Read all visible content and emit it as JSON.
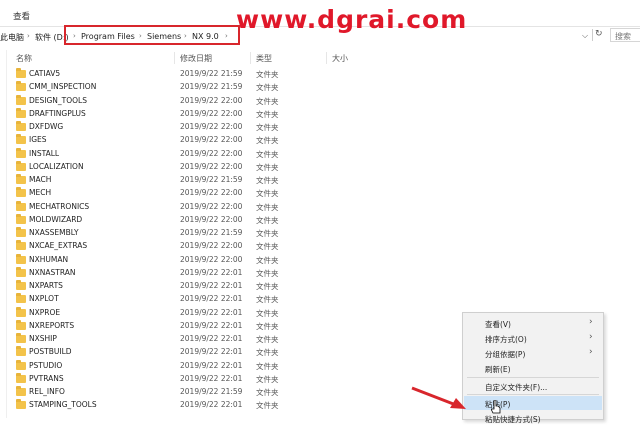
{
  "menubar": {
    "view": "查看"
  },
  "watermark": "www.dgrai.com",
  "address": {
    "pre1": "此电脑",
    "pre2": "软件 (D:)",
    "crumbs": [
      "Program Files",
      "Siemens",
      "NX 9.0"
    ]
  },
  "search_placeholder": "搜索",
  "columns": {
    "name": "名称",
    "date": "修改日期",
    "type": "类型",
    "size": "大小"
  },
  "files": [
    {
      "name": "CATIAV5",
      "date": "2019/9/22 21:59",
      "type": "文件夹"
    },
    {
      "name": "CMM_INSPECTION",
      "date": "2019/9/22 21:59",
      "type": "文件夹"
    },
    {
      "name": "DESIGN_TOOLS",
      "date": "2019/9/22 22:00",
      "type": "文件夹"
    },
    {
      "name": "DRAFTINGPLUS",
      "date": "2019/9/22 22:00",
      "type": "文件夹"
    },
    {
      "name": "DXFDWG",
      "date": "2019/9/22 22:00",
      "type": "文件夹"
    },
    {
      "name": "IGES",
      "date": "2019/9/22 22:00",
      "type": "文件夹"
    },
    {
      "name": "INSTALL",
      "date": "2019/9/22 22:00",
      "type": "文件夹"
    },
    {
      "name": "LOCALIZATION",
      "date": "2019/9/22 22:00",
      "type": "文件夹"
    },
    {
      "name": "MACH",
      "date": "2019/9/22 21:59",
      "type": "文件夹"
    },
    {
      "name": "MECH",
      "date": "2019/9/22 22:00",
      "type": "文件夹"
    },
    {
      "name": "MECHATRONICS",
      "date": "2019/9/22 22:00",
      "type": "文件夹"
    },
    {
      "name": "MOLDWIZARD",
      "date": "2019/9/22 22:00",
      "type": "文件夹"
    },
    {
      "name": "NXASSEMBLY",
      "date": "2019/9/22 21:59",
      "type": "文件夹"
    },
    {
      "name": "NXCAE_EXTRAS",
      "date": "2019/9/22 22:00",
      "type": "文件夹"
    },
    {
      "name": "NXHUMAN",
      "date": "2019/9/22 22:00",
      "type": "文件夹"
    },
    {
      "name": "NXNASTRAN",
      "date": "2019/9/22 22:01",
      "type": "文件夹"
    },
    {
      "name": "NXPARTS",
      "date": "2019/9/22 22:01",
      "type": "文件夹"
    },
    {
      "name": "NXPLOT",
      "date": "2019/9/22 22:01",
      "type": "文件夹"
    },
    {
      "name": "NXPROE",
      "date": "2019/9/22 22:01",
      "type": "文件夹"
    },
    {
      "name": "NXREPORTS",
      "date": "2019/9/22 22:01",
      "type": "文件夹"
    },
    {
      "name": "NXSHIP",
      "date": "2019/9/22 22:01",
      "type": "文件夹"
    },
    {
      "name": "POSTBUILD",
      "date": "2019/9/22 22:01",
      "type": "文件夹"
    },
    {
      "name": "PSTUDIO",
      "date": "2019/9/22 22:01",
      "type": "文件夹"
    },
    {
      "name": "PVTRANS",
      "date": "2019/9/22 22:01",
      "type": "文件夹"
    },
    {
      "name": "REL_INFO",
      "date": "2019/9/22 21:59",
      "type": "文件夹"
    },
    {
      "name": "STAMPING_TOOLS",
      "date": "2019/9/22 22:01",
      "type": "文件夹"
    }
  ],
  "context_menu": {
    "view": "查看(V)",
    "sort": "排序方式(O)",
    "group": "分组依据(P)",
    "refresh": "刷新(E)",
    "customize": "自定义文件夹(F)...",
    "paste": "粘贴(P)",
    "paste_shortcut": "粘贴快捷方式(S)"
  },
  "colors": {
    "highlight_box": "#d8262c",
    "watermark": "#e0182a",
    "folder": "#f3c34a",
    "menu_hover": "#cde3f7"
  }
}
